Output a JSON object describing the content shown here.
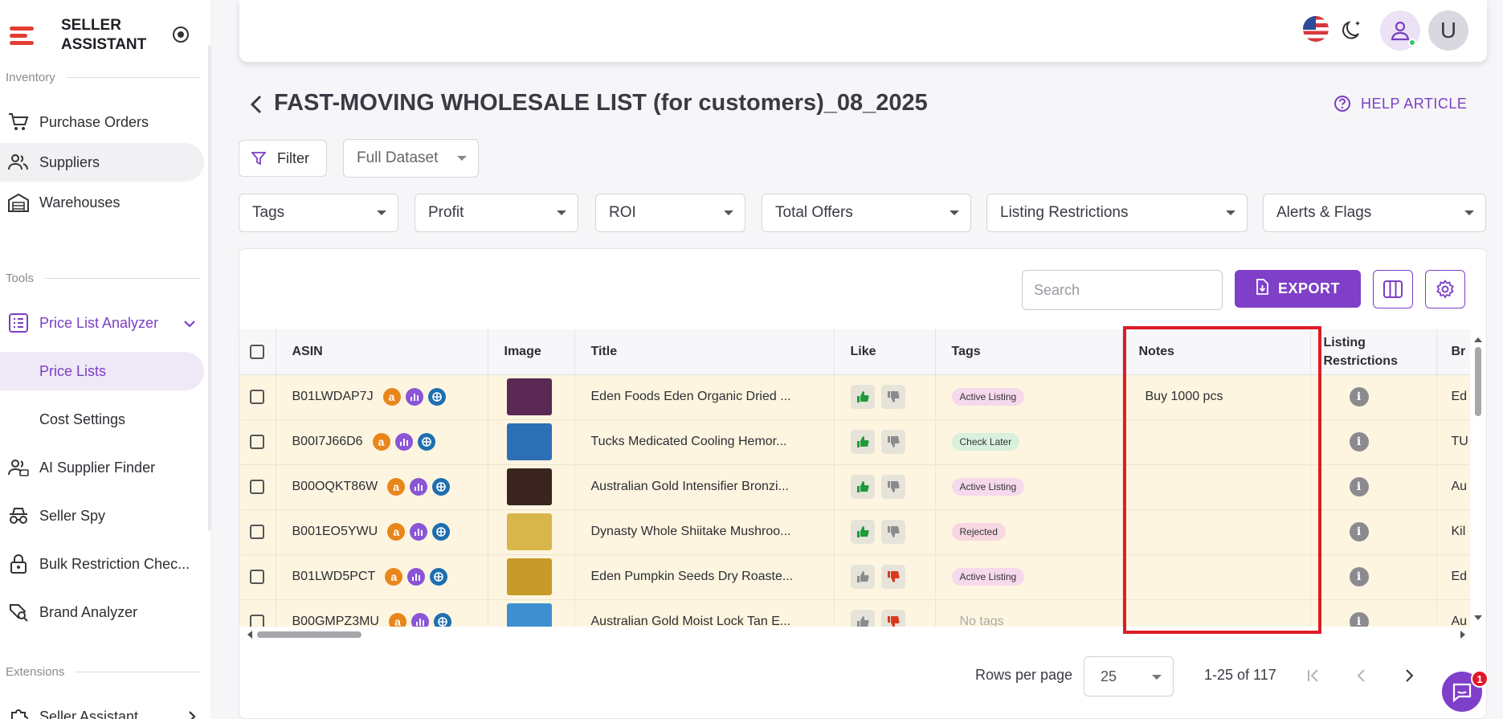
{
  "brand": {
    "line1": "SELLER",
    "line2": "ASSISTANT"
  },
  "sidebar": {
    "sections": {
      "inventory": "Inventory",
      "tools": "Tools",
      "extensions": "Extensions"
    },
    "items": [
      {
        "label": "Purchase Orders",
        "icon": "cart-icon"
      },
      {
        "label": "Suppliers",
        "icon": "users-icon"
      },
      {
        "label": "Warehouses",
        "icon": "warehouse-icon"
      },
      {
        "label": "Price List Analyzer",
        "icon": "list-icon"
      },
      {
        "label": "Price Lists"
      },
      {
        "label": "Cost Settings"
      },
      {
        "label": "AI Supplier Finder",
        "icon": "ai-users-icon"
      },
      {
        "label": "Seller Spy",
        "icon": "spy-icon"
      },
      {
        "label": "Bulk Restriction Chec...",
        "icon": "lock-icon"
      },
      {
        "label": "Brand Analyzer",
        "icon": "search-brand-icon"
      },
      {
        "label": "Seller Assistant",
        "icon": "puzzle-icon"
      }
    ]
  },
  "header": {
    "avatar_letter": "U"
  },
  "page": {
    "title": "FAST-MOVING WHOLESALE LIST (for customers)_08_2025",
    "help_label": "HELP ARTICLE"
  },
  "filters": {
    "filter_label": "Filter",
    "dataset": "Full Dataset",
    "selects": [
      "Tags",
      "Profit",
      "ROI",
      "Total Offers",
      "Listing Restrictions",
      "Alerts & Flags"
    ]
  },
  "toolbar": {
    "search_placeholder": "Search",
    "export_label": "EXPORT"
  },
  "table": {
    "columns": [
      "ASIN",
      "Image",
      "Title",
      "Like",
      "Tags",
      "Notes",
      "Listing Restrictions",
      "Br"
    ],
    "rows": [
      {
        "asin": "B01LWDAP7J",
        "title": "Eden Foods Eden Organic Dried ...",
        "liked": true,
        "disliked": false,
        "tag": "Active Listing",
        "tag_type": "active",
        "notes": "Buy 1000 pcs",
        "brand": "Ed",
        "img": "#5a2a55"
      },
      {
        "asin": "B00I7J66D6",
        "title": "Tucks Medicated Cooling Hemor...",
        "liked": true,
        "disliked": false,
        "tag": "Check Later",
        "tag_type": "check",
        "notes": "",
        "brand": "TU",
        "img": "#2d6fb5"
      },
      {
        "asin": "B00OQKT86W",
        "title": "Australian Gold Intensifier Bronzi...",
        "liked": true,
        "disliked": false,
        "tag": "Active Listing",
        "tag_type": "active",
        "notes": "",
        "brand": "Au",
        "img": "#3a2420"
      },
      {
        "asin": "B001EO5YWU",
        "title": "Dynasty Whole Shiitake Mushroo...",
        "liked": true,
        "disliked": false,
        "tag": "Rejected",
        "tag_type": "rejected",
        "notes": "",
        "brand": "Kil",
        "img": "#d9b64a"
      },
      {
        "asin": "B01LWD5PCT",
        "title": "Eden Pumpkin Seeds Dry Roaste...",
        "liked": false,
        "disliked": true,
        "tag": "Active Listing",
        "tag_type": "active",
        "notes": "",
        "brand": "Ed",
        "img": "#c89a2a"
      },
      {
        "asin": "B00GMPZ3MU",
        "title": "Australian Gold Moist Lock Tan E...",
        "liked": false,
        "disliked": true,
        "tag": "No tags",
        "tag_type": "none",
        "notes": "",
        "brand": "Au",
        "img": "#3d8fd0"
      }
    ]
  },
  "pagination": {
    "rows_per_page_label": "Rows per page",
    "rows_per_page": "25",
    "range": "1-25 of 117"
  },
  "chat": {
    "badge": "1"
  },
  "colors": {
    "accent": "#7f3fc9",
    "highlight": "#dd1d26",
    "row_bg": "#fdf5e0"
  }
}
